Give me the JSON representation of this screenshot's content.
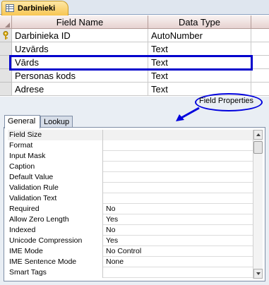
{
  "document_tab": {
    "title": "Darbinieki"
  },
  "grid": {
    "headers": {
      "field_name": "Field Name",
      "data_type": "Data Type"
    },
    "rows": [
      {
        "field_name": "Darbinieka ID",
        "data_type": "AutoNumber",
        "primary_key": true
      },
      {
        "field_name": "Uzvārds",
        "data_type": "Text"
      },
      {
        "field_name": "Vārds",
        "data_type": "Text",
        "highlighted": true
      },
      {
        "field_name": "Personas kods",
        "data_type": "Text"
      },
      {
        "field_name": "Adrese",
        "data_type": "Text"
      }
    ]
  },
  "field_properties": {
    "label": "Field Properties",
    "tabs": [
      {
        "label": "General",
        "active": true
      },
      {
        "label": "Lookup"
      }
    ],
    "properties": [
      {
        "name": "Field Size",
        "value": ""
      },
      {
        "name": "Format",
        "value": ""
      },
      {
        "name": "Input Mask",
        "value": ""
      },
      {
        "name": "Caption",
        "value": ""
      },
      {
        "name": "Default Value",
        "value": ""
      },
      {
        "name": "Validation Rule",
        "value": ""
      },
      {
        "name": "Validation Text",
        "value": ""
      },
      {
        "name": "Required",
        "value": "No"
      },
      {
        "name": "Allow Zero Length",
        "value": "Yes"
      },
      {
        "name": "Indexed",
        "value": "No"
      },
      {
        "name": "Unicode Compression",
        "value": "Yes"
      },
      {
        "name": "IME Mode",
        "value": "No Control"
      },
      {
        "name": "IME Sentence Mode",
        "value": "None"
      },
      {
        "name": "Smart Tags",
        "value": ""
      }
    ]
  },
  "colors": {
    "annotation": "#0000cc",
    "tab_active": "#f8c653",
    "header_bg": "#e6d2d0"
  },
  "icons": {
    "document_tab": "table-icon",
    "primary_key": "key-icon",
    "annotation_arrow": "arrow-icon"
  }
}
